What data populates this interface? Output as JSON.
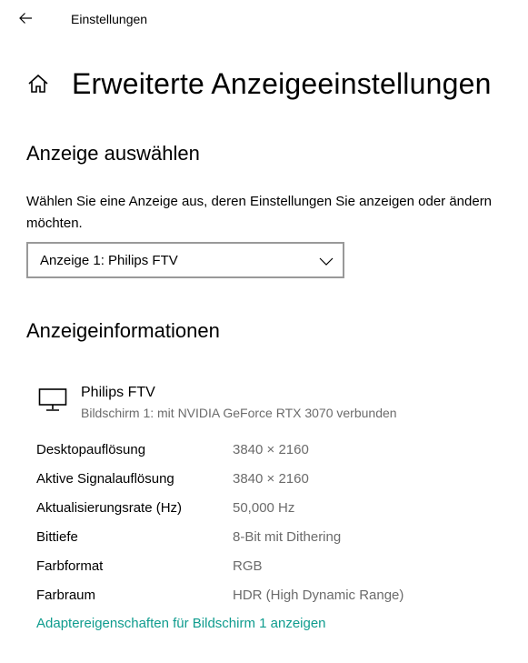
{
  "titlebar": {
    "title": "Einstellungen",
    "back_icon": "arrow-left-icon"
  },
  "header": {
    "home_icon": "home-icon",
    "title": "Erweiterte Anzeigeeinstellungen"
  },
  "select_display": {
    "heading": "Anzeige auswählen",
    "description": "Wählen Sie eine Anzeige aus, deren Einstellungen Sie anzeigen oder ändern möchten.",
    "dropdown_value": "Anzeige 1: Philips FTV"
  },
  "display_info": {
    "heading": "Anzeigeinformationen",
    "monitor_name": "Philips FTV",
    "monitor_subtitle": "Bildschirm 1: mit NVIDIA GeForce RTX 3070 verbunden",
    "rows": [
      {
        "label": "Desktopauflösung",
        "value": "3840 × 2160"
      },
      {
        "label": "Aktive Signalauflösung",
        "value": "3840 × 2160"
      },
      {
        "label": "Aktualisierungsrate (Hz)",
        "value": "50,000 Hz"
      },
      {
        "label": "Bittiefe",
        "value": "8-Bit mit Dithering"
      },
      {
        "label": "Farbformat",
        "value": "RGB"
      },
      {
        "label": "Farbraum",
        "value": "HDR (High Dynamic Range)"
      }
    ],
    "adapter_link": "Adaptereigenschaften für Bildschirm 1 anzeigen"
  },
  "colors": {
    "link": "#0f9c8e",
    "secondary_text": "#6b6b6b",
    "dropdown_border": "#999999"
  }
}
